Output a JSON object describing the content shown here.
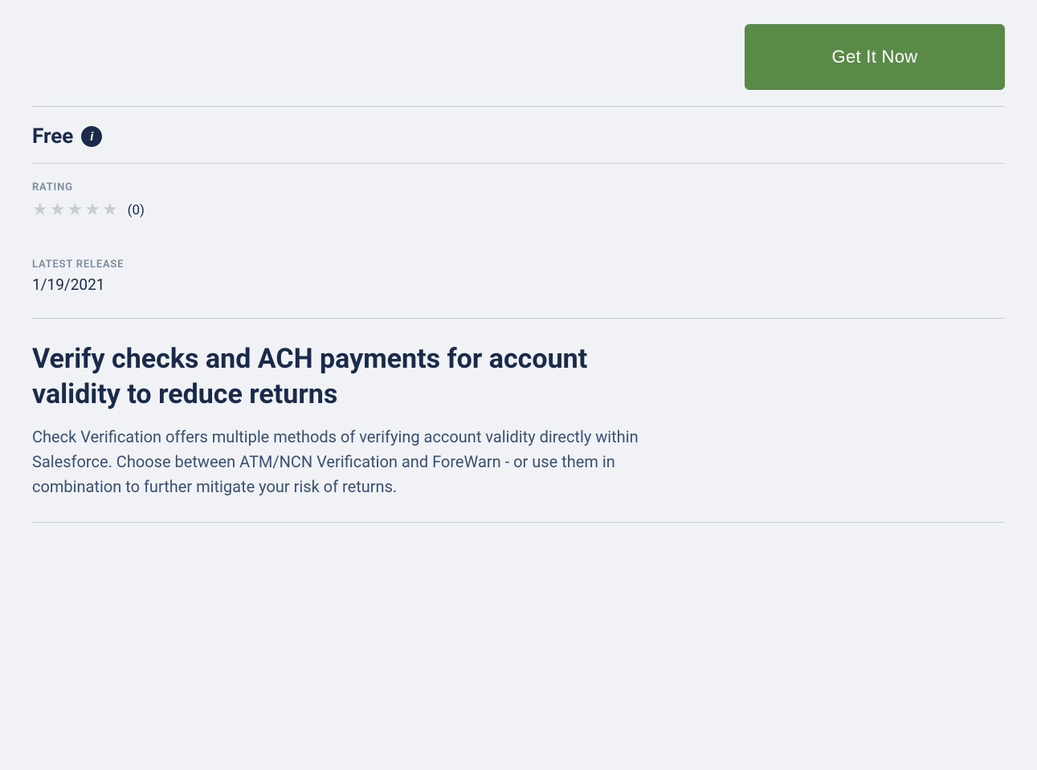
{
  "page": {
    "background": "#f0f2f5"
  },
  "cta": {
    "button_label": "Get It Now"
  },
  "pricing": {
    "price_label": "Free",
    "info_icon_symbol": "i"
  },
  "rating": {
    "section_label": "RATING",
    "stars_count": 5,
    "rating_value": 0,
    "rating_display": "(0)"
  },
  "latest_release": {
    "section_label": "LATEST RELEASE",
    "date": "1/19/2021"
  },
  "description": {
    "headline": "Verify checks and ACH payments for account validity to reduce returns",
    "body": "Check Verification offers multiple methods of verifying account validity directly within Salesforce. Choose between ATM/NCN Verification and ForeWarn - or use them in combination to further mitigate your risk of returns."
  }
}
